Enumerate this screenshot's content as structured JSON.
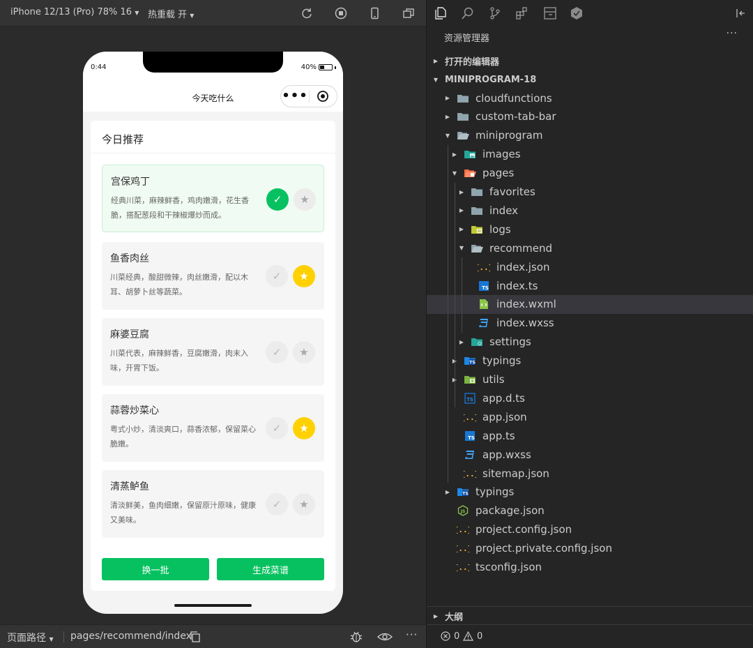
{
  "sim_toolbar": {
    "device": "iPhone 12/13 (Pro) 78% 16",
    "hot_reload": "热重载 开",
    "icons": [
      "refresh-icon",
      "stop-icon",
      "phone-icon",
      "window-icon"
    ]
  },
  "phone": {
    "status_time": "0:44",
    "battery": "40%",
    "battery_level": 0.4,
    "nav_title": "今天吃什么",
    "capsule_dots": "•••",
    "card_title": "今日推荐",
    "dishes": [
      {
        "name": "宫保鸡丁",
        "desc": "经典川菜，麻辣鲜香，鸡肉嫩滑，花生香脆，搭配葱段和干辣椒爆炒而成。",
        "selected": true,
        "favorite": false
      },
      {
        "name": "鱼香肉丝",
        "desc": "川菜经典，酸甜微辣，肉丝嫩滑，配以木耳、胡萝卜丝等蔬菜。",
        "selected": false,
        "favorite": true
      },
      {
        "name": "麻婆豆腐",
        "desc": "川菜代表，麻辣鲜香，豆腐嫩滑，肉末入味，开胃下饭。",
        "selected": false,
        "favorite": false
      },
      {
        "name": "蒜蓉炒菜心",
        "desc": "粤式小炒，清淡爽口，蒜香浓郁，保留菜心脆嫩。",
        "selected": false,
        "favorite": true
      },
      {
        "name": "清蒸鲈鱼",
        "desc": "清淡鲜美，鱼肉细嫩，保留原汁原味，健康又美味。",
        "selected": false,
        "favorite": false
      }
    ],
    "check_glyph": "✓",
    "star_glyph": "★",
    "btn_refresh": "换一批",
    "btn_generate": "生成菜谱"
  },
  "sim_bottom": {
    "path_label": "页面路径",
    "path_value": "pages/recommend/index"
  },
  "explorer": {
    "title": "资源管理器",
    "more": "···",
    "open_editors": "打开的编辑器",
    "project": "MINIPROGRAM-18",
    "outline": "大纲",
    "errors": "0",
    "warnings": "0",
    "tree": [
      {
        "label": "cloudfunctions",
        "depth": 0,
        "chev": "▶",
        "icon": "folder-icon"
      },
      {
        "label": "custom-tab-bar",
        "depth": 0,
        "chev": "▶",
        "icon": "folder-icon"
      },
      {
        "label": "miniprogram",
        "depth": 0,
        "chev": "▼",
        "icon": "folder-open-icon"
      },
      {
        "label": "images",
        "depth": 1,
        "chev": "▶",
        "icon": "images-folder-icon"
      },
      {
        "label": "pages",
        "depth": 1,
        "chev": "▼",
        "icon": "pages-folder-icon"
      },
      {
        "label": "favorites",
        "depth": 2,
        "chev": "▶",
        "icon": "folder-icon"
      },
      {
        "label": "index",
        "depth": 2,
        "chev": "▶",
        "icon": "folder-icon"
      },
      {
        "label": "logs",
        "depth": 2,
        "chev": "▶",
        "icon": "logs-folder-icon"
      },
      {
        "label": "recommend",
        "depth": 2,
        "chev": "▼",
        "icon": "folder-open-icon"
      },
      {
        "label": "index.json",
        "depth": 3,
        "chev": "",
        "icon": "json-file-icon"
      },
      {
        "label": "index.ts",
        "depth": 3,
        "chev": "",
        "icon": "ts-file-icon"
      },
      {
        "label": "index.wxml",
        "depth": 3,
        "chev": "",
        "icon": "wxml-file-icon",
        "active": true
      },
      {
        "label": "index.wxss",
        "depth": 3,
        "chev": "",
        "icon": "css-file-icon"
      },
      {
        "label": "settings",
        "depth": 2,
        "chev": "▶",
        "icon": "settings-folder-icon"
      },
      {
        "label": "typings",
        "depth": 1,
        "chev": "▶",
        "icon": "ts-folder-icon"
      },
      {
        "label": "utils",
        "depth": 1,
        "chev": "▶",
        "icon": "utils-folder-icon"
      },
      {
        "label": "app.d.ts",
        "depth": 1,
        "chev": "",
        "icon": "dts-file-icon"
      },
      {
        "label": "app.json",
        "depth": 1,
        "chev": "",
        "icon": "json-file-icon"
      },
      {
        "label": "app.ts",
        "depth": 1,
        "chev": "",
        "icon": "ts-file-icon"
      },
      {
        "label": "app.wxss",
        "depth": 1,
        "chev": "",
        "icon": "css-file-icon"
      },
      {
        "label": "sitemap.json",
        "depth": 1,
        "chev": "",
        "icon": "json-file-icon"
      },
      {
        "label": "typings",
        "depth": 0,
        "chev": "▶",
        "icon": "ts-folder-icon"
      },
      {
        "label": "package.json",
        "depth": 0,
        "chev": "",
        "icon": "node-file-icon"
      },
      {
        "label": "project.config.json",
        "depth": 0,
        "chev": "",
        "icon": "json-file-icon"
      },
      {
        "label": "project.private.config.json",
        "depth": 0,
        "chev": "",
        "icon": "json-file-icon"
      },
      {
        "label": "tsconfig.json",
        "depth": 0,
        "chev": "",
        "icon": "json-file-icon"
      }
    ]
  },
  "colors": {
    "wechat_green": "#07c160",
    "star_yellow": "#ffd100",
    "editor_bg": "#252526",
    "active_row": "#37373d"
  }
}
